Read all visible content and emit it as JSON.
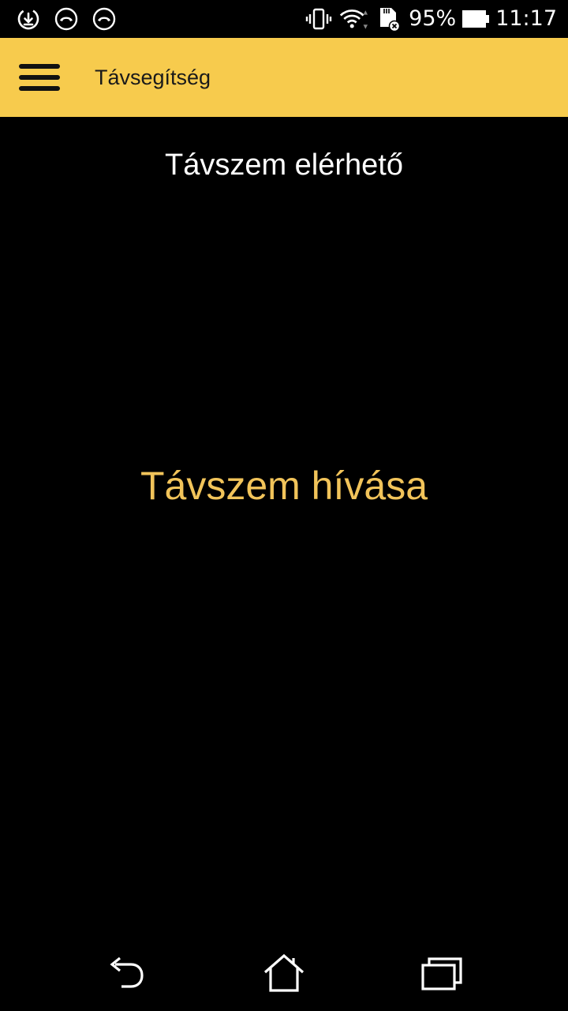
{
  "status_bar": {
    "left_icons": [
      "download-status-icon",
      "missed-call-icon",
      "missed-call-icon"
    ],
    "right_icons": [
      "vibrate-icon",
      "wifi-icon",
      "sd-card-error-icon"
    ],
    "battery_percent": "95%",
    "battery_level": 0.95,
    "time": "11:17"
  },
  "toolbar": {
    "title": "Távsegítség",
    "background": "#f7cb4d",
    "menu_icon": "hamburger-menu-icon"
  },
  "main": {
    "status_text": "Távszem elérhető",
    "call_label": "Távszem hívása",
    "call_color": "#f2c45a"
  },
  "nav_bar": {
    "buttons": [
      "back-icon",
      "home-icon",
      "recents-icon"
    ]
  }
}
